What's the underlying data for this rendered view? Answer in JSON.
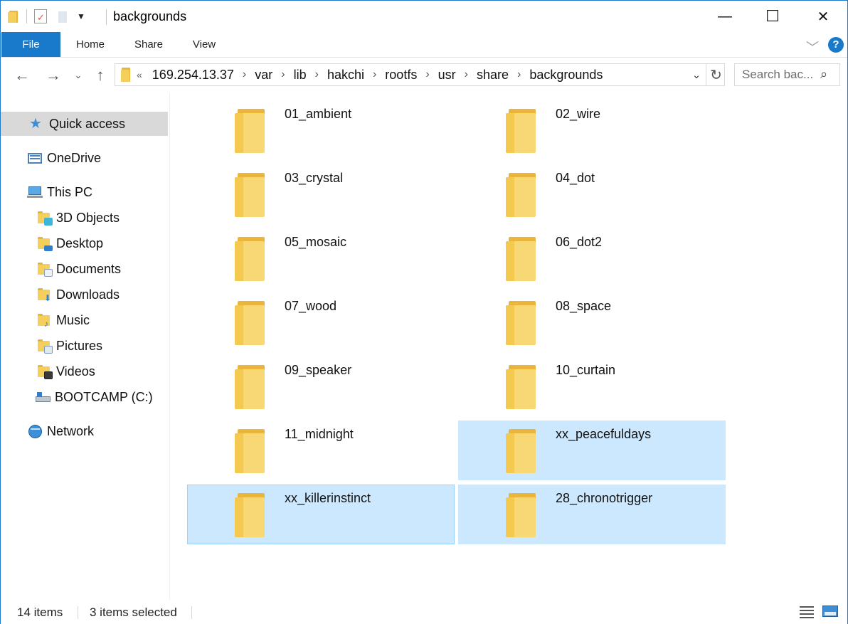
{
  "window": {
    "title": "backgrounds",
    "controls": {
      "minimize": "—",
      "maximize": "☐",
      "close": "✕"
    }
  },
  "ribbon": {
    "tabs": [
      "File",
      "Home",
      "Share",
      "View"
    ],
    "help": "?"
  },
  "address": {
    "overflow": "«",
    "crumbs": [
      "169.254.13.37",
      "var",
      "lib",
      "hakchi",
      "rootfs",
      "usr",
      "share",
      "backgrounds"
    ]
  },
  "search": {
    "placeholder": "Search bac..."
  },
  "sidebar": {
    "items": [
      {
        "label": "Quick access",
        "icon": "star-icon"
      },
      {
        "label": "OneDrive",
        "icon": "onedrive-icon"
      },
      {
        "label": "This PC",
        "icon": "computer-icon"
      },
      {
        "label": "3D Objects",
        "icon": "3d-objects-folder-icon"
      },
      {
        "label": "Desktop",
        "icon": "desktop-folder-icon"
      },
      {
        "label": "Documents",
        "icon": "documents-folder-icon"
      },
      {
        "label": "Downloads",
        "icon": "downloads-folder-icon"
      },
      {
        "label": "Music",
        "icon": "music-folder-icon"
      },
      {
        "label": "Pictures",
        "icon": "pictures-folder-icon"
      },
      {
        "label": "Videos",
        "icon": "videos-folder-icon"
      },
      {
        "label": "BOOTCAMP (C:)",
        "icon": "drive-icon"
      },
      {
        "label": "Network",
        "icon": "network-icon"
      }
    ]
  },
  "folders": [
    {
      "name": "01_ambient",
      "selected": false
    },
    {
      "name": "02_wire",
      "selected": false
    },
    {
      "name": "03_crystal",
      "selected": false
    },
    {
      "name": "04_dot",
      "selected": false
    },
    {
      "name": "05_mosaic",
      "selected": false
    },
    {
      "name": "06_dot2",
      "selected": false
    },
    {
      "name": "07_wood",
      "selected": false
    },
    {
      "name": "08_space",
      "selected": false
    },
    {
      "name": "09_speaker",
      "selected": false
    },
    {
      "name": "10_curtain",
      "selected": false
    },
    {
      "name": "11_midnight",
      "selected": false
    },
    {
      "name": "xx_peacefuldays",
      "selected": true
    },
    {
      "name": "xx_killerinstinct",
      "selected": true
    },
    {
      "name": "28_chronotrigger",
      "selected": true
    }
  ],
  "status": {
    "item_count": "14 items",
    "selection": "3 items selected"
  },
  "colors": {
    "accent": "#1979ca",
    "selection": "#cce8ff",
    "focus_border": "#99d1ff",
    "folder": "#f8d775"
  }
}
